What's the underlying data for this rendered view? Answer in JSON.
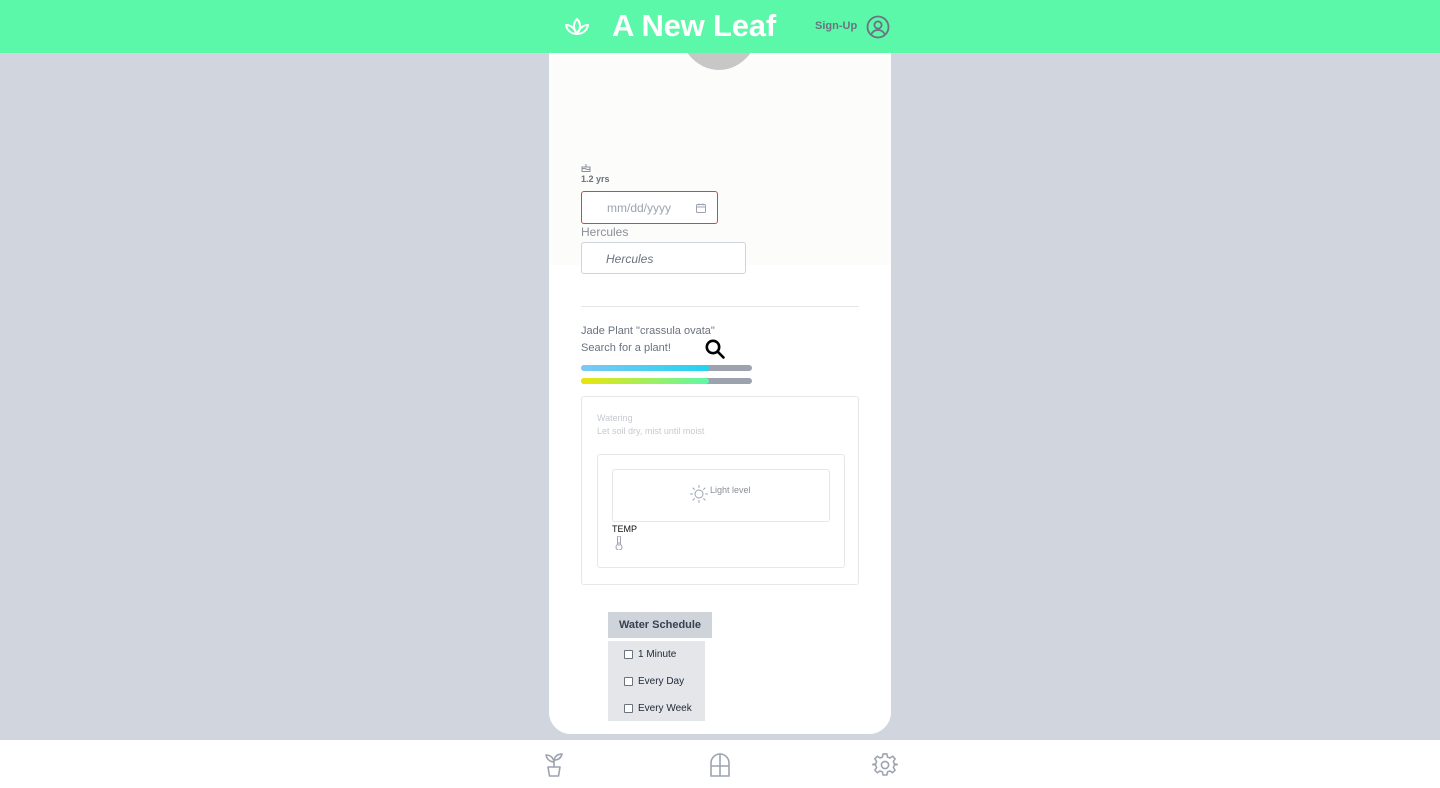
{
  "header": {
    "title": "A New Leaf",
    "signup_label": "Sign-Up",
    "logo_icon": "lotus-leaf-icon",
    "user_icon": "user-circle-icon",
    "background": "#5cf8a9"
  },
  "plant": {
    "age": "1.2 yrs",
    "birthday_placeholder": "mm/dd/yyyy",
    "name_label": "Hercules",
    "name_placeholder": "Hercules",
    "species": "Jade Plant \"crassula ovata\"",
    "search_label": "Search for a plant!"
  },
  "bars": [
    {
      "name": "water-level-bar",
      "fraction": 0.75,
      "gradient": [
        "#7ec8f5",
        "#22d3ee"
      ]
    },
    {
      "name": "light-level-bar",
      "fraction": 0.75,
      "gradient": [
        "#ece40a",
        "#5cf8a9"
      ]
    }
  ],
  "care": {
    "watering_title": "Watering",
    "watering_desc": "Let soil dry, mist until moist",
    "light_label": "Light level",
    "temp_label": "TEMP"
  },
  "water_schedule": {
    "button_label": "Water Schedule",
    "options": [
      "1 Minute",
      "Every Day",
      "Every Week"
    ]
  },
  "footer": {
    "icons": [
      "plant-icon",
      "window-icon",
      "settings-icon"
    ]
  }
}
